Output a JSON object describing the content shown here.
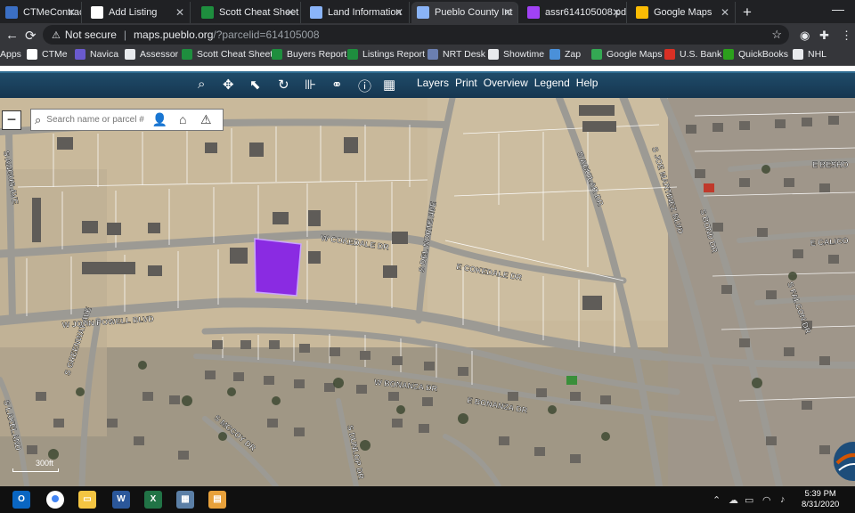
{
  "tabs": [
    {
      "label": "CTMeContracts.co",
      "color": "#3b6fc4"
    },
    {
      "label": "Add Listing",
      "color": "#ffffff"
    },
    {
      "label": "Scott Cheat Sheet",
      "color": "#1e8e3e"
    },
    {
      "label": "Land Information",
      "color": "#8ab4f8"
    },
    {
      "label": "Pueblo County Int",
      "color": "#8ab4f8"
    },
    {
      "label": "assr614105008.pd",
      "color": "#a142f4"
    },
    {
      "label": "Google Maps",
      "color": "#fbbc04"
    }
  ],
  "address_bar": {
    "security": "Not secure",
    "host": "maps.pueblo.org",
    "path": "/?parcelid=614105008"
  },
  "bookmarks": [
    {
      "label": "Apps",
      "color": "#8ab4f8"
    },
    {
      "label": "CTMe",
      "color": "#ffffff"
    },
    {
      "label": "Navica",
      "color": "#6a5acd"
    },
    {
      "label": "Assessor",
      "color": "#e8eaed"
    },
    {
      "label": "Scott Cheat Sheet",
      "color": "#1e8e3e"
    },
    {
      "label": "Buyers Report",
      "color": "#1e8e3e"
    },
    {
      "label": "Listings Report",
      "color": "#1e8e3e"
    },
    {
      "label": "NRT Desk",
      "color": "#6b7fb0"
    },
    {
      "label": "Showtime",
      "color": "#e8eaed"
    },
    {
      "label": "Zap",
      "color": "#4a90d9"
    },
    {
      "label": "Google Maps",
      "color": "#34a853"
    },
    {
      "label": "U.S. Bank",
      "color": "#d93025"
    },
    {
      "label": "QuickBooks",
      "color": "#2ca01c"
    },
    {
      "label": "NHL",
      "color": "#e8eaed"
    }
  ],
  "map_menu": [
    "Layers",
    "Print",
    "Overview",
    "Legend",
    "Help"
  ],
  "search": {
    "placeholder": "Search name or parcel #"
  },
  "streets": {
    "cokedale_w": "W COKEDALE DR",
    "cokedale_e": "E COKEDALE DR",
    "john_powell": "W JOHN POWELL BLVD",
    "del_norte": "S DEL NORTE AVE",
    "aguilar": "S AGUILAR DR",
    "joe_martinez": "S JOE MARTINEZ BLVD",
    "bond": "S BOND DR",
    "besho": "E BESHO",
    "calico": "E CALICO",
    "falcon": "S FALCON DR",
    "bonanza_w": "W BONANZA DR",
    "bonanza_e": "E BONANZA DR",
    "mccoy": "S MCCOY DR",
    "dunlop": "S DUNLOP DR",
    "greenway": "S GREENWAY AVE",
    "lakeland": "S LAKELAND",
    "angus": "S ANGUS AVE"
  },
  "scale": {
    "label": "300ft"
  },
  "colors": {
    "parcel": "#8a2be2",
    "app_header": "#1f4b69"
  },
  "clock": {
    "time": "5:39 PM",
    "date": "8/31/2020"
  }
}
